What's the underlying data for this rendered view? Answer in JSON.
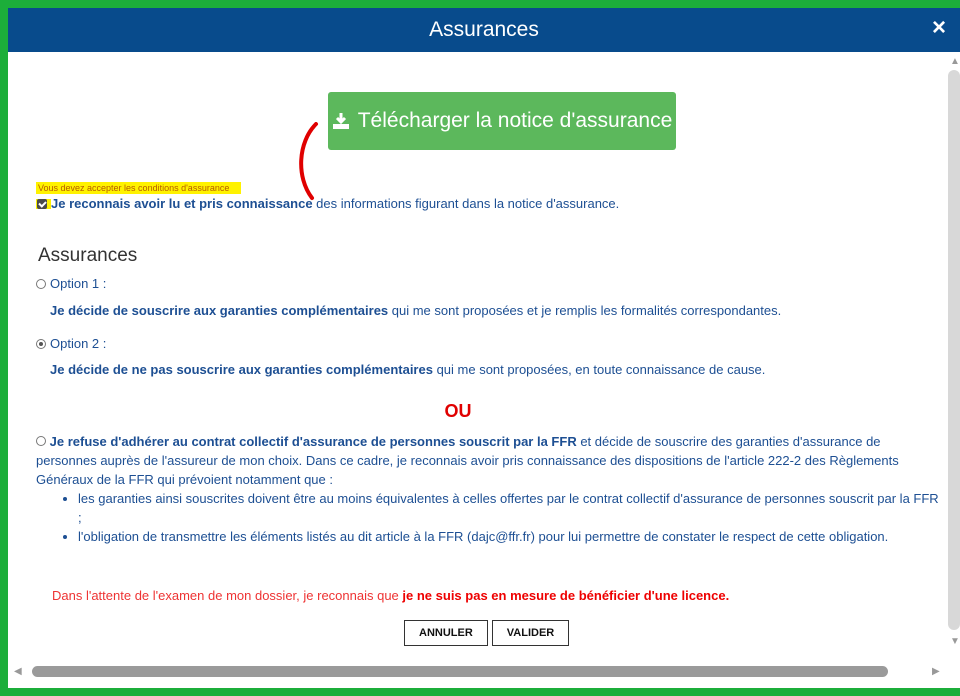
{
  "dialog": {
    "title": "Assurances",
    "close_icon": "×"
  },
  "download_button": {
    "label": "Télécharger la notice d'assurance",
    "icon": "download-icon",
    "color": "#5cb85c"
  },
  "warning": "Vous devez accepter les conditions d'assurance",
  "acknowledge": {
    "checked": true,
    "bold": "Je reconnais avoir lu et pris connaissance",
    "rest": " des informations figurant dans la notice d'assurance."
  },
  "section_title": "Assurances",
  "option1": {
    "label": "Option 1 :",
    "selected": false,
    "desc_bold": "Je décide de souscrire aux garanties complémentaires",
    "desc_rest": " qui me sont proposées et je remplis les formalités correspondantes."
  },
  "option2": {
    "label": "Option 2 :",
    "selected": true,
    "desc_bold": "Je décide de ne pas souscrire aux garanties complémentaires",
    "desc_rest": " qui me sont proposées, en toute connaissance de cause."
  },
  "ou": "OU",
  "refuse": {
    "bold": "Je refuse d'adhérer au contrat collectif d'assurance de personnes souscrit par la FFR",
    "rest": " et décide de souscrire des garanties d'assurance de personnes auprès de l'assureur de mon choix. Dans ce cadre, je reconnais avoir pris connaissance des dispositions de l'article 222-2 des Règlements Généraux de la FFR qui prévoient notamment que :",
    "bullets": [
      "les garanties ainsi souscrites doivent être au moins équivalentes à celles offertes par le contrat collectif d'assurance de personnes souscrit par la FFR ;",
      "l'obligation de transmettre les éléments listés au dit article à la FFR (dajc@ffr.fr) pour lui permettre de constater le respect de cette obligation."
    ]
  },
  "notice": {
    "text": "Dans l'attente de l'examen de mon dossier, je reconnais que ",
    "bold": "je ne suis pas en mesure de bénéficier d'une licence."
  },
  "buttons": {
    "cancel": "ANNULER",
    "validate": "VALIDER"
  },
  "colors": {
    "header": "#084b8c",
    "frame": "#1cae3a",
    "text": "#1d4f93",
    "highlight": "#fff200",
    "red": "#e00000"
  }
}
